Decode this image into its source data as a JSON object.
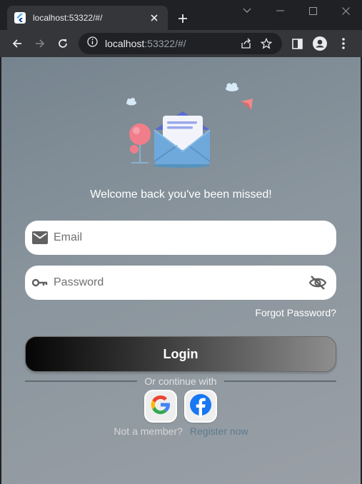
{
  "browser": {
    "tab_title": "localhost:53322/#/",
    "url_host": "localhost",
    "url_rest": ":53322/#/",
    "icons": {
      "favicon": "flutter-icon",
      "close": "close-icon",
      "new_tab": "plus-icon",
      "back": "arrow-left-icon",
      "forward": "arrow-right-icon",
      "reload": "reload-icon",
      "site_info": "info-icon",
      "share": "share-icon",
      "bookmark": "star-icon",
      "side_panel": "side-panel-icon",
      "profile": "profile-icon",
      "menu": "kebab-menu-icon"
    }
  },
  "page": {
    "welcome": "Welcome back you've been missed!",
    "email_placeholder": "Email",
    "password_placeholder": "Password",
    "forgot_password": "Forgot Password?",
    "login_label": "Login",
    "or_continue": "Or continue with",
    "not_member": "Not a member?",
    "register_now": "Register now",
    "colors": {
      "register_link": "#5d7b8f",
      "background_start": "#76848f",
      "background_end": "#9a9fa6"
    }
  }
}
